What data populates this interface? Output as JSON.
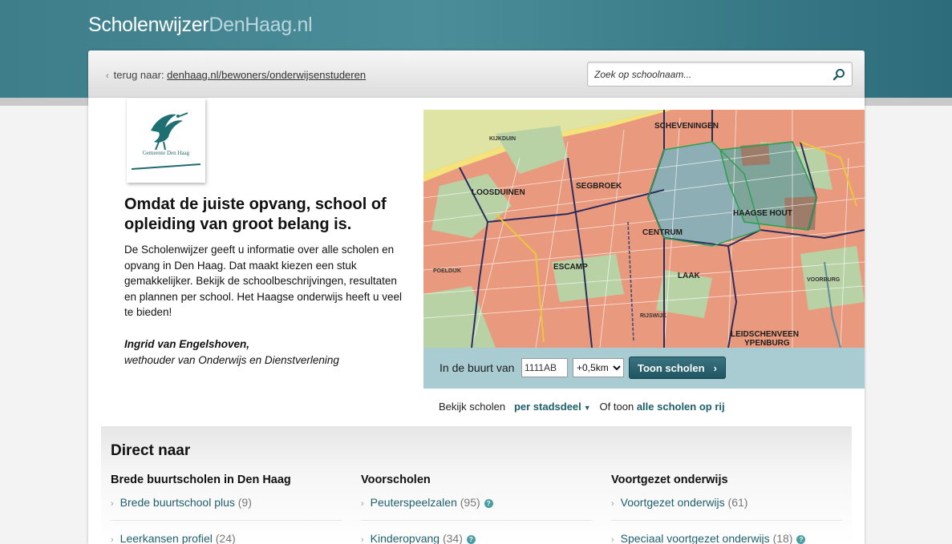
{
  "site": {
    "brand_part1": "Scholenwijzer",
    "brand_part2": "DenHaag.nl"
  },
  "topbar": {
    "back_prefix": "terug naar:",
    "back_link": "denhaag.nl/bewoners/onderwijsenstuderen",
    "search_placeholder": "Zoek op schoolnaam..."
  },
  "logo": {
    "city_name": "Gemeente Den Haag"
  },
  "intro": {
    "title": "Omdat de juiste opvang, school of opleiding van groot belang is.",
    "text": "De Scholenwijzer geeft u informatie over alle scholen en opvang in Den Haag. Dat maakt kiezen een stuk gemakkelijker. Bekijk de schoolbeschrijvingen, resultaten en plannen per school. Het Haagse onderwijs heeft u veel te bieden!",
    "signature_name": "Ingrid van Engelshoven,",
    "signature_role": "wethouder van Onderwijs en Dienstverlening"
  },
  "map": {
    "districts": {
      "scheveningen": "SCHEVENINGEN",
      "kijkduin": "KIJKDUIN",
      "loosduinen": "LOOSDUINEN",
      "segbroek": "SEGBROEK",
      "haagse_hout": "HAAGSE HOUT",
      "centrum": "CENTRUM",
      "escamp": "ESCAMP",
      "laak": "LAAK",
      "leidschenveen": "LEIDSCHENVEEN",
      "ypenburg": "YPENBURG",
      "rijswijk": "RIJSWIJK",
      "voorburg": "VOORBURG",
      "poeldijk": "POELDIJK"
    },
    "colors": {
      "urban": "#e99a7e",
      "green": "#b8d2a6",
      "water": "#8fbcd6",
      "selected": "#8eaeb6",
      "sea": "#dfe3a4"
    }
  },
  "finder": {
    "label": "In de buurt van",
    "postcode_value": "1111AB",
    "distance_value": "+0,5km",
    "button_label": "Toon scholen"
  },
  "browse": {
    "prefix": "Bekijk scholen",
    "per_district": "per stadsdeel",
    "or_show": "Of toon",
    "all_schools": "alle scholen op rij"
  },
  "direct": {
    "title": "Direct naar",
    "columns": [
      {
        "heading": "Brede buurtscholen in Den Haag",
        "items": [
          {
            "label": "Brede buurtschool plus",
            "count": "(9)"
          },
          {
            "label": "Leerkansen profiel",
            "count": "(24)"
          }
        ]
      },
      {
        "heading": "Voorscholen",
        "items": [
          {
            "label": "Peuterspeelzalen",
            "count": "(95)"
          },
          {
            "label": "Kinderopvang",
            "count": "(34)"
          }
        ]
      },
      {
        "heading": "Voortgezet onderwijs",
        "items": [
          {
            "label": "Voortgezet onderwijs",
            "count": "(61)"
          },
          {
            "label": "Speciaal voortgezet onderwijs",
            "count": "(18)"
          }
        ]
      }
    ]
  }
}
